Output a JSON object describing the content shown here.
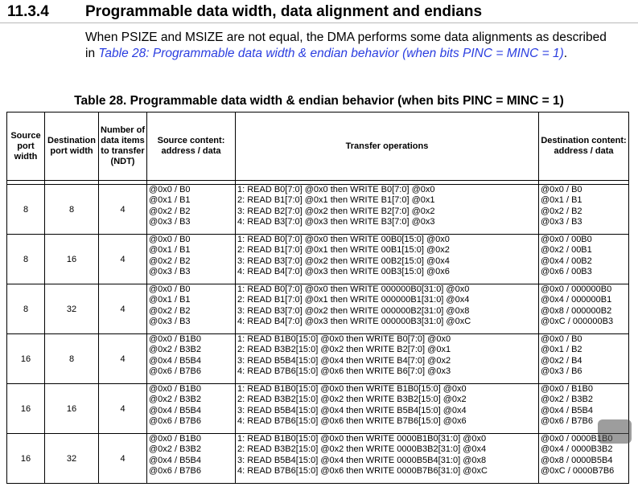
{
  "section": {
    "number": "11.3.4",
    "title": "Programmable data width, data alignment and endians"
  },
  "intro": {
    "text_before": "When PSIZE and MSIZE are not equal, the DMA performs some data alignments as described in ",
    "link": "Table 28: Programmable data width & endian behavior (when bits PINC = MINC = 1)",
    "text_after": "."
  },
  "table": {
    "caption": "Table 28. Programmable data width & endian behavior (when bits PINC = MINC = 1)",
    "headers": {
      "src_width": "Source port width",
      "dst_width": "Destination port width",
      "ndt": "Number of data items to transfer (NDT)",
      "src_content": "Source content: address / data",
      "transfer": "Transfer operations",
      "dst_content": "Destination content: address / data"
    },
    "rows": [
      {
        "src_width": "8",
        "dst_width": "8",
        "ndt": "4",
        "src": [
          "@0x0 / B0",
          "@0x1 / B1",
          "@0x2 / B2",
          "@0x3 / B3"
        ],
        "ops": [
          "1: READ B0[7:0] @0x0 then WRITE B0[7:0] @0x0",
          "2: READ B1[7:0] @0x1 then WRITE B1[7:0] @0x1",
          "3: READ B2[7:0] @0x2 then WRITE B2[7:0] @0x2",
          "4: READ B3[7:0] @0x3 then WRITE B3[7:0] @0x3"
        ],
        "dst": [
          "@0x0 / B0",
          "@0x1 / B1",
          "@0x2 / B2",
          "@0x3 / B3"
        ]
      },
      {
        "src_width": "8",
        "dst_width": "16",
        "ndt": "4",
        "src": [
          "@0x0 / B0",
          "@0x1 / B1",
          "@0x2 / B2",
          "@0x3 / B3"
        ],
        "ops": [
          "1: READ B0[7:0] @0x0 then WRITE 00B0[15:0] @0x0",
          "2: READ B1[7:0] @0x1 then WRITE 00B1[15:0] @0x2",
          "3: READ B3[7:0] @0x2 then WRITE 00B2[15:0] @0x4",
          "4: READ B4[7:0] @0x3 then WRITE 00B3[15:0] @0x6"
        ],
        "dst": [
          "@0x0 / 00B0",
          "@0x2 / 00B1",
          "@0x4 / 00B2",
          "@0x6 / 00B3"
        ]
      },
      {
        "src_width": "8",
        "dst_width": "32",
        "ndt": "4",
        "src": [
          "@0x0 / B0",
          "@0x1 / B1",
          "@0x2 / B2",
          "@0x3 / B3"
        ],
        "ops": [
          "1: READ B0[7:0] @0x0 then WRITE 000000B0[31:0] @0x0",
          "2: READ B1[7:0] @0x1 then WRITE 000000B1[31:0] @0x4",
          "3: READ B3[7:0] @0x2 then WRITE 000000B2[31:0] @0x8",
          "4: READ B4[7:0] @0x3 then WRITE 000000B3[31:0] @0xC"
        ],
        "dst": [
          "@0x0 / 000000B0",
          "@0x4 / 000000B1",
          "@0x8 / 000000B2",
          "@0xC / 000000B3"
        ]
      },
      {
        "src_width": "16",
        "dst_width": "8",
        "ndt": "4",
        "src": [
          "@0x0 / B1B0",
          "@0x2 / B3B2",
          "@0x4 / B5B4",
          "@0x6 / B7B6"
        ],
        "ops": [
          "1: READ B1B0[15:0] @0x0 then WRITE B0[7:0] @0x0",
          "2: READ B3B2[15:0] @0x2 then WRITE B2[7:0] @0x1",
          "3: READ B5B4[15:0] @0x4 then WRITE B4[7:0] @0x2",
          "4: READ B7B6[15:0] @0x6 then WRITE B6[7:0] @0x3"
        ],
        "dst": [
          "@0x0 / B0",
          "@0x1 / B2",
          "@0x2 / B4",
          "@0x3 / B6"
        ]
      },
      {
        "src_width": "16",
        "dst_width": "16",
        "ndt": "4",
        "src": [
          "@0x0 / B1B0",
          "@0x2 / B3B2",
          "@0x4 / B5B4",
          "@0x6 / B7B6"
        ],
        "ops": [
          "1: READ B1B0[15:0] @0x0 then WRITE B1B0[15:0] @0x0",
          "2: READ B3B2[15:0] @0x2 then WRITE B3B2[15:0] @0x2",
          "3: READ B5B4[15:0] @0x4 then WRITE B5B4[15:0] @0x4",
          "4: READ B7B6[15:0] @0x6 then WRITE B7B6[15:0] @0x6"
        ],
        "dst": [
          "@0x0 / B1B0",
          "@0x2 / B3B2",
          "@0x4 / B5B4",
          "@0x6 / B7B6"
        ]
      },
      {
        "src_width": "16",
        "dst_width": "32",
        "ndt": "4",
        "src": [
          "@0x0 / B1B0",
          "@0x2 / B3B2",
          "@0x4 / B5B4",
          "@0x6 / B7B6"
        ],
        "ops": [
          "1: READ B1B0[15:0] @0x0 then WRITE 0000B1B0[31:0] @0x0",
          "2: READ B3B2[15:0] @0x2 then WRITE 0000B3B2[31:0] @0x4",
          "3: READ B5B4[15:0] @0x4 then WRITE 0000B5B4[31:0] @0x8",
          "4: READ B7B6[15:0] @0x6 then WRITE 0000B7B6[31:0] @0xC"
        ],
        "dst": [
          "@0x0 / 0000B1B0",
          "@0x4 / 0000B3B2",
          "@0x8 / 0000B5B4",
          "@0xC / 0000B7B6"
        ]
      }
    ]
  }
}
